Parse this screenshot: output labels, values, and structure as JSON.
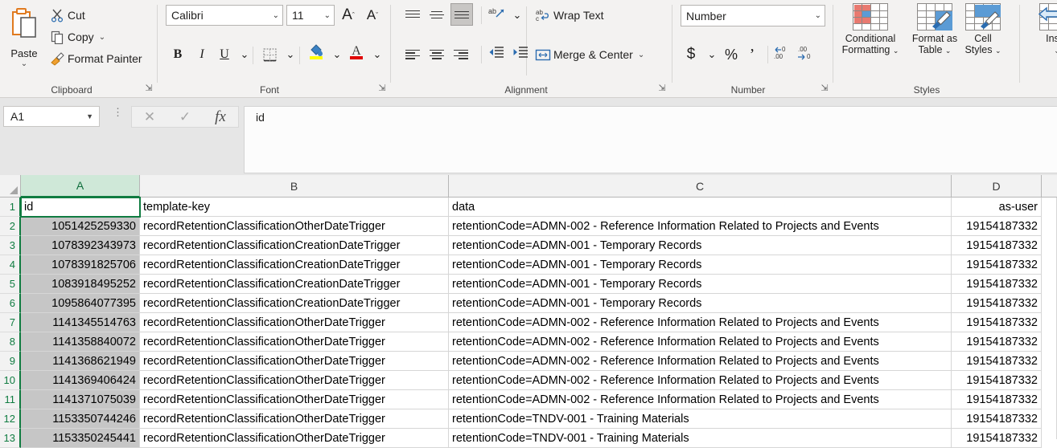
{
  "ribbon": {
    "groups": [
      {
        "name": "clipboard",
        "label": "Clipboard"
      },
      {
        "name": "font",
        "label": "Font"
      },
      {
        "name": "alignment",
        "label": "Alignment"
      },
      {
        "name": "number",
        "label": "Number"
      },
      {
        "name": "styles",
        "label": "Styles"
      }
    ],
    "clipboard": {
      "paste_label": "Paste",
      "cut_label": "Cut",
      "copy_label": "Copy",
      "format_painter_label": "Format Painter"
    },
    "font": {
      "font_name": "Calibri",
      "font_size": "11",
      "grow_font": "A",
      "shrink_font": "A",
      "bold": "B",
      "italic": "I",
      "underline": "U"
    },
    "alignment": {
      "wrap_text_label": "Wrap Text",
      "merge_center_label": "Merge & Center",
      "orientation_label": "ab"
    },
    "number": {
      "format_value": "Number",
      "accounting": "$",
      "percent": "%",
      "comma": "`",
      "increase_decimal": ".00",
      "decrease_decimal": ".00"
    },
    "styles": {
      "conditional_formatting_line1": "Conditional",
      "conditional_formatting_line2": "Formatting",
      "format_as_table_line1": "Format as",
      "format_as_table_line2": "Table",
      "cell_styles_line1": "Cell",
      "cell_styles_line2": "Styles"
    },
    "cells": {
      "insert_label": "Inser"
    }
  },
  "formula_bar": {
    "name_box_value": "A1",
    "cancel_icon": "✕",
    "enter_icon": "✓",
    "function_icon": "fx",
    "formula_value": "id"
  },
  "grid": {
    "columns": [
      {
        "letter": "A",
        "selected": true
      },
      {
        "letter": "B",
        "selected": false
      },
      {
        "letter": "C",
        "selected": false
      },
      {
        "letter": "D",
        "selected": false
      }
    ],
    "headers": [
      "id",
      "template-key",
      "data",
      "as-user"
    ],
    "active_cell": "A1",
    "selected_column": "A",
    "row_numbers": [
      "1",
      "2",
      "3",
      "4",
      "5",
      "6",
      "7",
      "8",
      "9",
      "10",
      "11",
      "12",
      "13"
    ],
    "rows": [
      {
        "n": "1",
        "id": "id",
        "template_key": "template-key",
        "data": "data",
        "as_user": "as-user"
      },
      {
        "n": "2",
        "id": "1051425259330",
        "template_key": "recordRetentionClassificationOtherDateTrigger",
        "data": "retentionCode=ADMN-002 - Reference Information Related to Projects and Events",
        "as_user": "19154187332"
      },
      {
        "n": "3",
        "id": "1078392343973",
        "template_key": "recordRetentionClassificationCreationDateTrigger",
        "data": "retentionCode=ADMN-001 - Temporary Records",
        "as_user": "19154187332"
      },
      {
        "n": "4",
        "id": "1078391825706",
        "template_key": "recordRetentionClassificationCreationDateTrigger",
        "data": "retentionCode=ADMN-001 - Temporary Records",
        "as_user": "19154187332"
      },
      {
        "n": "5",
        "id": "1083918495252",
        "template_key": "recordRetentionClassificationCreationDateTrigger",
        "data": "retentionCode=ADMN-001 - Temporary Records",
        "as_user": "19154187332"
      },
      {
        "n": "6",
        "id": "1095864077395",
        "template_key": "recordRetentionClassificationCreationDateTrigger",
        "data": "retentionCode=ADMN-001 - Temporary Records",
        "as_user": "19154187332"
      },
      {
        "n": "7",
        "id": "1141345514763",
        "template_key": "recordRetentionClassificationOtherDateTrigger",
        "data": "retentionCode=ADMN-002 - Reference Information Related to Projects and Events",
        "as_user": "19154187332"
      },
      {
        "n": "8",
        "id": "1141358840072",
        "template_key": "recordRetentionClassificationOtherDateTrigger",
        "data": "retentionCode=ADMN-002 - Reference Information Related to Projects and Events",
        "as_user": "19154187332"
      },
      {
        "n": "9",
        "id": "1141368621949",
        "template_key": "recordRetentionClassificationOtherDateTrigger",
        "data": "retentionCode=ADMN-002 - Reference Information Related to Projects and Events",
        "as_user": "19154187332"
      },
      {
        "n": "10",
        "id": "1141369406424",
        "template_key": "recordRetentionClassificationOtherDateTrigger",
        "data": "retentionCode=ADMN-002 - Reference Information Related to Projects and Events",
        "as_user": "19154187332"
      },
      {
        "n": "11",
        "id": "1141371075039",
        "template_key": "recordRetentionClassificationOtherDateTrigger",
        "data": "retentionCode=ADMN-002 - Reference Information Related to Projects and Events",
        "as_user": "19154187332"
      },
      {
        "n": "12",
        "id": "1153350744246",
        "template_key": "recordRetentionClassificationOtherDateTrigger",
        "data": "retentionCode=TNDV-001 - Training Materials",
        "as_user": "19154187332"
      },
      {
        "n": "13",
        "id": "1153350245441",
        "template_key": "recordRetentionClassificationOtherDateTrigger",
        "data": "retentionCode=TNDV-001 - Training Materials",
        "as_user": "19154187332"
      }
    ]
  },
  "colors": {
    "accent_green": "#107c41",
    "header_selected_bg": "#cfe8d8",
    "selection_fill": "#c6c6c6",
    "ribbon_bg": "#f3f2f1",
    "formula_bar_bg": "#e6e6e6",
    "grid_line": "#d6d6d6"
  }
}
